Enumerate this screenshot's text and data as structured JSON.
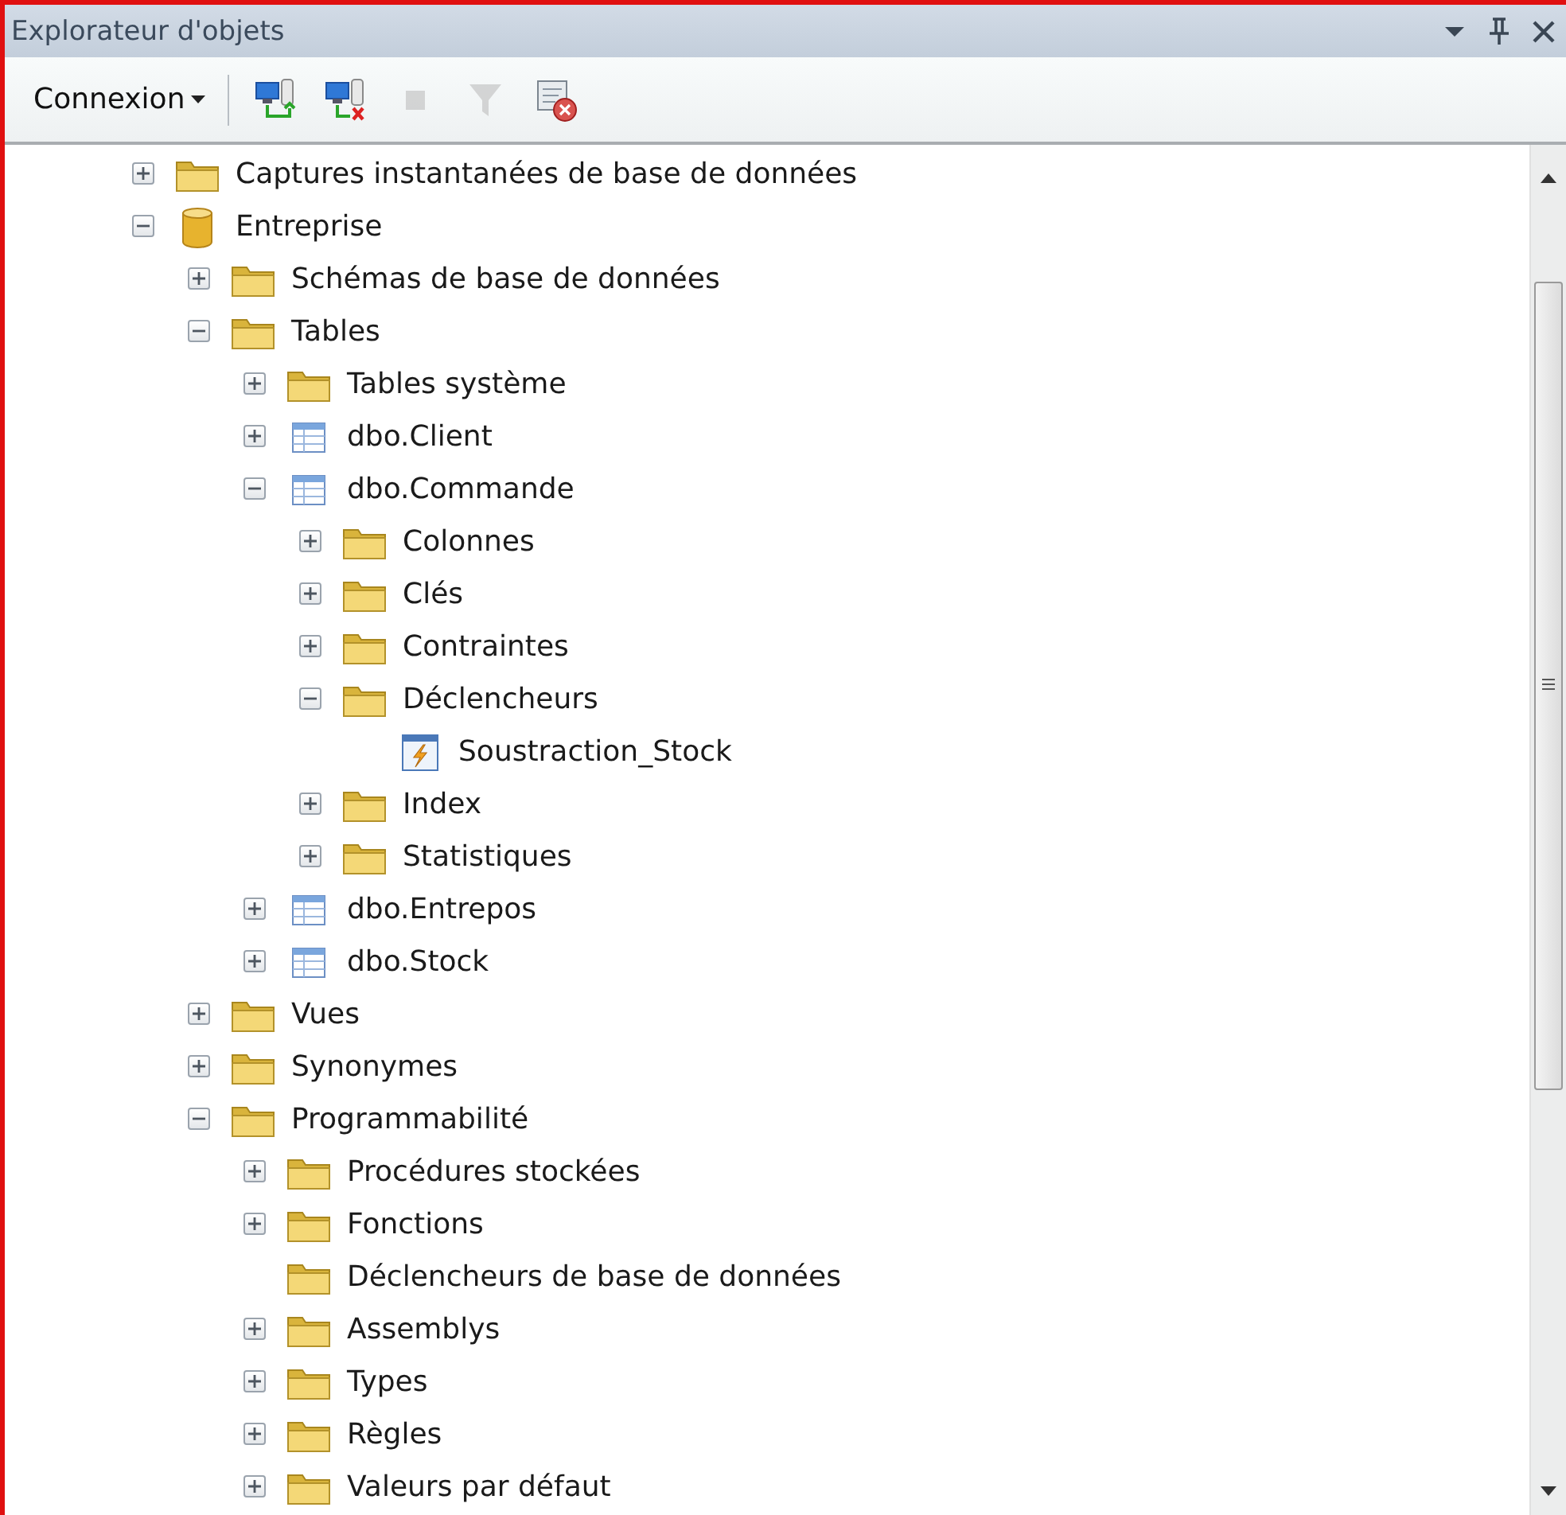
{
  "window": {
    "title": "Explorateur d'objets"
  },
  "toolbar": {
    "menu": {
      "label": "Connexion"
    },
    "buttons": [
      {
        "kind": "connect",
        "disabled": false
      },
      {
        "kind": "disconnect",
        "disabled": false
      },
      {
        "kind": "stop",
        "disabled": true
      },
      {
        "kind": "filter",
        "disabled": true
      },
      {
        "kind": "refresh",
        "disabled": false
      }
    ]
  },
  "tree": [
    {
      "label": "Captures instantanées de base de données",
      "kind": "folder",
      "expanded": false
    },
    {
      "label": "Entreprise",
      "kind": "database",
      "expanded": true,
      "children": [
        {
          "label": "Schémas de base de données",
          "kind": "folder",
          "expanded": false
        },
        {
          "label": "Tables",
          "kind": "folder",
          "expanded": true,
          "children": [
            {
              "label": "Tables système",
              "kind": "folder",
              "expanded": false
            },
            {
              "label": "dbo.Client",
              "kind": "table",
              "expanded": false
            },
            {
              "label": "dbo.Commande",
              "kind": "table",
              "expanded": true,
              "children": [
                {
                  "label": "Colonnes",
                  "kind": "folder",
                  "expanded": false
                },
                {
                  "label": "Clés",
                  "kind": "folder",
                  "expanded": false
                },
                {
                  "label": "Contraintes",
                  "kind": "folder",
                  "expanded": false
                },
                {
                  "label": "Déclencheurs",
                  "kind": "folder",
                  "expanded": true,
                  "children": [
                    {
                      "label": "Soustraction_Stock",
                      "kind": "trigger"
                    }
                  ]
                },
                {
                  "label": "Index",
                  "kind": "folder",
                  "expanded": false
                },
                {
                  "label": "Statistiques",
                  "kind": "folder",
                  "expanded": false
                }
              ]
            },
            {
              "label": "dbo.Entrepos",
              "kind": "table",
              "expanded": false
            },
            {
              "label": "dbo.Stock",
              "kind": "table",
              "expanded": false
            }
          ]
        },
        {
          "label": "Vues",
          "kind": "folder",
          "expanded": false
        },
        {
          "label": "Synonymes",
          "kind": "folder",
          "expanded": false
        },
        {
          "label": "Programmabilité",
          "kind": "folder",
          "expanded": true,
          "children": [
            {
              "label": "Procédures stockées",
              "kind": "folder",
              "expanded": false
            },
            {
              "label": "Fonctions",
              "kind": "folder",
              "expanded": false
            },
            {
              "label": "Déclencheurs de base de données",
              "kind": "folder"
            },
            {
              "label": "Assemblys",
              "kind": "folder",
              "expanded": false
            },
            {
              "label": "Types",
              "kind": "folder",
              "expanded": false
            },
            {
              "label": "Règles",
              "kind": "folder",
              "expanded": false
            },
            {
              "label": "Valeurs par défaut",
              "kind": "folder",
              "expanded": false
            }
          ]
        }
      ]
    }
  ]
}
